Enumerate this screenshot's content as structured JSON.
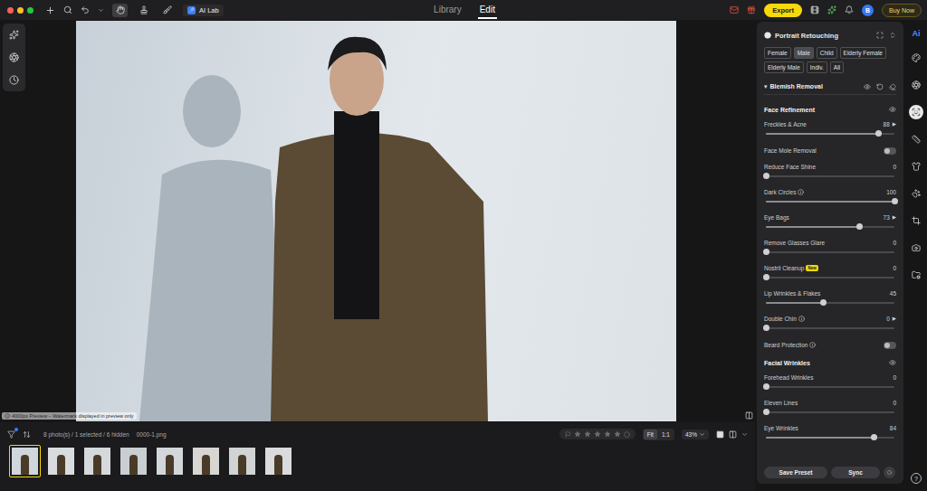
{
  "topbar": {
    "tools": [
      {
        "selected": true
      },
      {
        "selected": false
      },
      {
        "selected": false
      }
    ],
    "ai_lab": "AI Lab",
    "tabs": [
      {
        "label": "Library",
        "selected": false
      },
      {
        "label": "Edit",
        "selected": true
      }
    ],
    "export": "Export",
    "avatar": "B",
    "buy": "Buy Now"
  },
  "canvas": {
    "note": "4000px Preview – Watermark displayed in preview only"
  },
  "panel": {
    "title": "Portrait Retouching",
    "filters": [
      {
        "label": "Female",
        "selected": false
      },
      {
        "label": "Male",
        "selected": true
      },
      {
        "label": "Child",
        "selected": false
      },
      {
        "label": "Elderly Female",
        "selected": false
      },
      {
        "label": "Elderly Male",
        "selected": false
      },
      {
        "label": "Indiv.",
        "selected": false
      },
      {
        "label": "All",
        "selected": false
      }
    ],
    "section": {
      "label": "Blemish Removal",
      "caret": "▾",
      "expanded": true
    },
    "groups": [
      {
        "title": "Face Refinement",
        "rows": [
          {
            "kind": "slider",
            "label": "Freckles & Acne",
            "value": "88",
            "level": 0.88,
            "arrow": "▶",
            "info": false
          },
          {
            "kind": "toggle",
            "label": "Face Mole Removal",
            "on": false,
            "info": false
          },
          {
            "kind": "slider",
            "label": "Reduce Face Shine",
            "value": "0",
            "level": 0,
            "info": false
          },
          {
            "kind": "slider",
            "label": "Dark Circles",
            "value": "100",
            "level": 1,
            "info": true
          },
          {
            "kind": "slider",
            "label": "Eye Bags",
            "value": "73",
            "level": 0.73,
            "arrow": "▶",
            "info": false
          },
          {
            "kind": "slider",
            "label": "Remove Glasses Glare",
            "value": "0",
            "level": 0,
            "info": false
          },
          {
            "kind": "slider",
            "label": "Nostril Cleanup",
            "badge": "New",
            "value": "0",
            "level": 0,
            "info": false
          },
          {
            "kind": "slider",
            "label": "Lip Wrinkles & Flakes",
            "value": "45",
            "level": 0.45,
            "info": false
          },
          {
            "kind": "slider",
            "label": "Double Chin",
            "value": "0",
            "level": 0,
            "arrow": "▶",
            "info": true
          },
          {
            "kind": "toggle",
            "label": "Beard Protection",
            "on": false,
            "info": true
          }
        ]
      },
      {
        "title": "Facial Wrinkles",
        "rows": [
          {
            "kind": "slider",
            "label": "Forehead Wrinkles",
            "value": "0",
            "level": 0,
            "info": false
          },
          {
            "kind": "slider",
            "label": "Eleven Lines",
            "value": "0",
            "level": 0,
            "info": false
          },
          {
            "kind": "slider",
            "label": "Eye Wrinkles",
            "value": "84",
            "level": 0.84,
            "info": false
          }
        ]
      }
    ],
    "save": "Save Preset",
    "sync": "Sync"
  },
  "sidebar": {
    "logo": "Ai",
    "help": "?",
    "items": [
      {
        "selected": false
      },
      {
        "selected": false
      },
      {
        "selected": true
      },
      {
        "selected": false
      },
      {
        "selected": false
      },
      {
        "selected": false
      },
      {
        "selected": false
      },
      {
        "selected": false
      },
      {
        "selected": false
      }
    ]
  },
  "filmstrip": {
    "info": "8 photo(s) / 1 selected / 6 hidden",
    "file": "0000-1.png",
    "stars": 0,
    "zoom": [
      {
        "label": "Fit",
        "selected": true
      },
      {
        "label": "1:1",
        "selected": false
      }
    ],
    "zoom_level": "43%",
    "thumbs": [
      {
        "selected": true
      },
      {
        "selected": false
      },
      {
        "selected": false
      },
      {
        "selected": false
      },
      {
        "selected": false
      },
      {
        "selected": false
      },
      {
        "selected": false
      },
      {
        "selected": false
      }
    ]
  }
}
